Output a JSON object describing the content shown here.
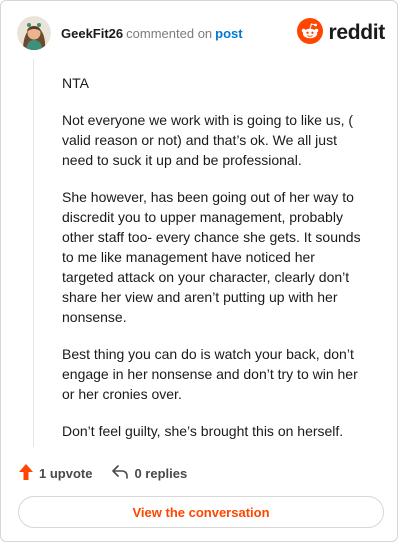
{
  "comment": {
    "username": "GeekFit26",
    "action_text": "commented on",
    "target_link": "post",
    "brand": "reddit",
    "paragraphs": [
      "NTA",
      "Not everyone we work with is going to like us, ( valid reason or not) and that’s ok. We all just need to suck it up and be professional.",
      "She however, has been going out of her way to discredit you to upper management, probably other staff too- every chance she gets. It sounds to me like management have noticed her targeted attack on your character, clearly don’t share her view and aren’t putting up with her nonsense.",
      "Best thing you can do is watch your back, don’t engage in her nonsense and don’t try to win her or her cronies over.",
      "Don’t feel guilty, she’s brought this on herself."
    ]
  },
  "actions": {
    "upvote_label": "1 upvote",
    "replies_label": "0 replies",
    "view_button": "View the conversation"
  },
  "colors": {
    "accent": "#ff4500",
    "link": "#0079d3",
    "muted": "#7c7c7c"
  },
  "icons": [
    "avatar",
    "reddit-logo-icon",
    "upvote-arrow-icon",
    "reply-icon"
  ]
}
